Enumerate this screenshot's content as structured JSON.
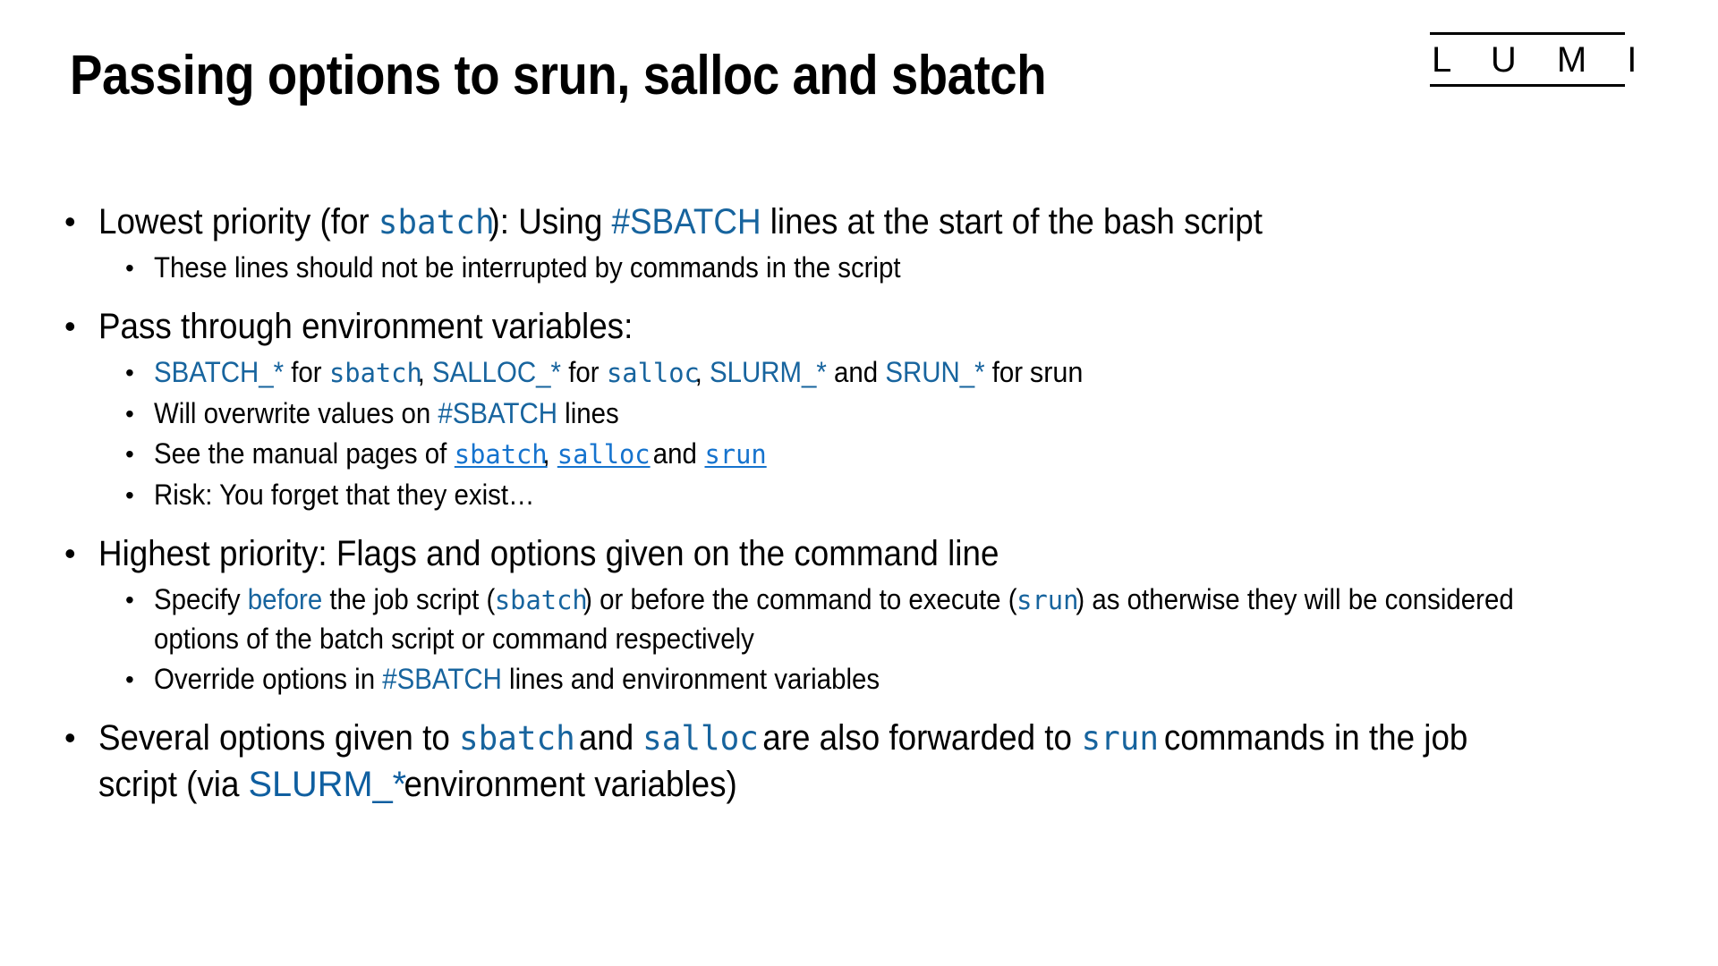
{
  "slide": {
    "title": "Passing options to srun, salloc and sbatch",
    "logo": {
      "word": "L U M I"
    },
    "bullet_glyph": "•",
    "colors": {
      "text": "#000000",
      "keyword_blue": "#17649E",
      "link_blue": "#1573CE",
      "background": "#FFFFFF"
    },
    "bullets": {
      "b1": {
        "p1": "Lowest priority (for ",
        "code1": "sbatch",
        "p2": "): Using ",
        "kw1": "#SBATCH",
        "p3": " lines at the start of the bash script"
      },
      "b1s1": {
        "text": "These lines should not be interrupted by commands in the script"
      },
      "b2": {
        "text": "Pass through environment variables:"
      },
      "b2s1": {
        "kw1": "SBATCH_*",
        "p1": " for ",
        "code1": "sbatch",
        "p2": ", ",
        "kw2": "SALLOC_*",
        "p3": " for ",
        "code2": "salloc",
        "p4": ", ",
        "kw3": "SLURM_*",
        "p5": " and ",
        "kw4": "SRUN_*",
        "p6": " for ",
        "plain1": "srun"
      },
      "b2s2": {
        "p1": "Will overwrite values on ",
        "kw1": "#SBATCH",
        "p2": " lines"
      },
      "b2s3": {
        "p1": "See the manual pages of ",
        "link1": "sbatch",
        "p2": ", ",
        "link2": "salloc",
        "p3": " and ",
        "link3": "srun"
      },
      "b2s4": {
        "text": "Risk: You forget that they exist…"
      },
      "b3": {
        "text": "Highest priority: Flags and options given on the command line"
      },
      "b3s1": {
        "p1": "Specify ",
        "kw1": "before",
        "p2": " the job script (",
        "code1": "sbatch",
        "p3": ") or before the command to execute (",
        "code2": "srun",
        "p4": ") as otherwise they will be considered options of the batch script or command respectively"
      },
      "b3s2": {
        "p1": "Override options in ",
        "kw1": "#SBATCH",
        "p2": " lines and environment variables"
      },
      "b4": {
        "p1": "Several options given to ",
        "code1": "sbatch",
        "p2": " and ",
        "code2": "salloc",
        "p3": " are also forwarded to ",
        "code3": "srun",
        "p4": " commands in the job script (via ",
        "kw1": "SLURM_*",
        "p5": " environment variables)"
      }
    }
  }
}
